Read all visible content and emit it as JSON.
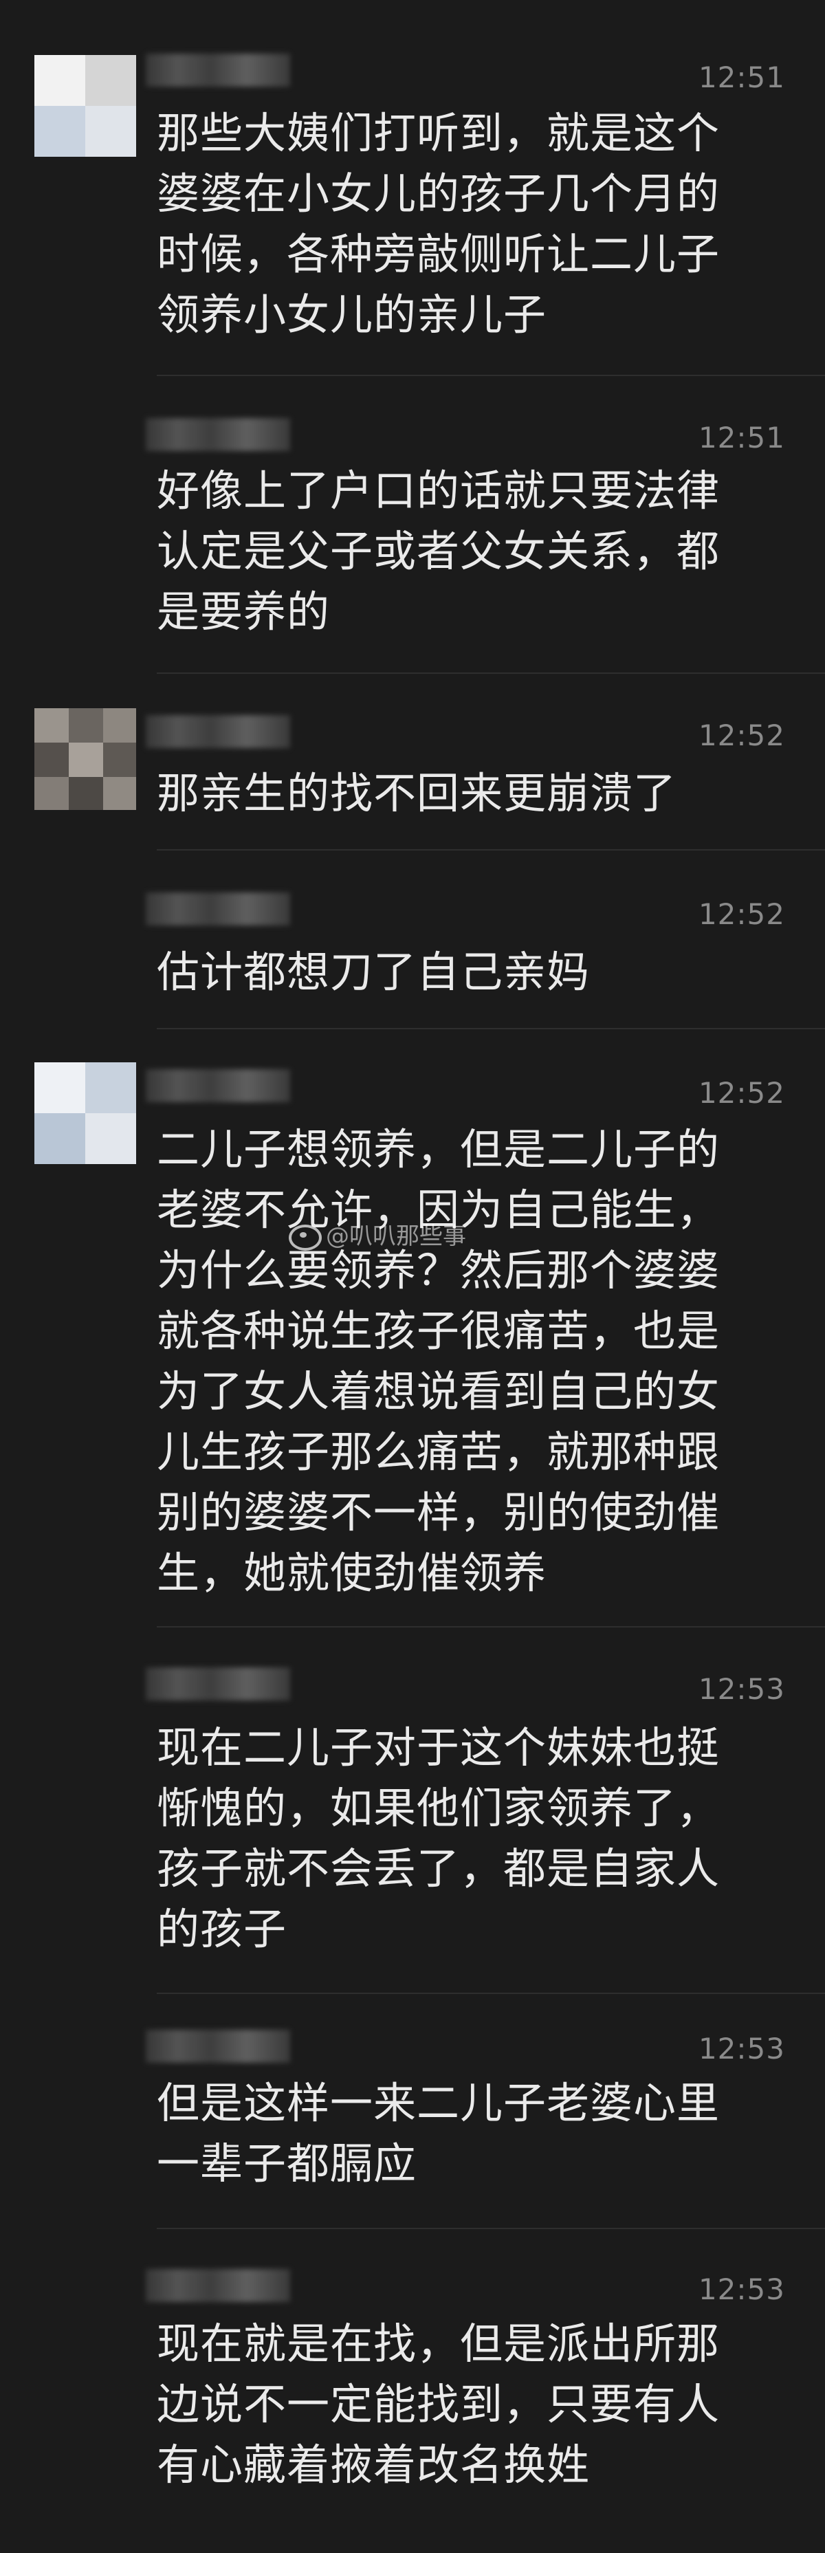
{
  "chat": {
    "messages": [
      {
        "time": "12:51",
        "lines": [
          "那些大姨们打听到，就是这个",
          "婆婆在小女儿的孩子几个月的",
          "时候，各种旁敲侧听让二儿子",
          "领养小女儿的亲儿子"
        ]
      },
      {
        "time": "12:51",
        "lines": [
          "好像上了户口的话就只要法律",
          "认定是父子或者父女关系，都",
          "是要养的"
        ]
      },
      {
        "time": "12:52",
        "lines": [
          "那亲生的找不回来更崩溃了"
        ]
      },
      {
        "time": "12:52",
        "lines": [
          "估计都想刀了自己亲妈"
        ]
      },
      {
        "time": "12:52",
        "lines": [
          "二儿子想领养，但是二儿子的",
          "老婆不允许，因为自己能生，",
          "为什么要领养？然后那个婆婆",
          "就各种说生孩子很痛苦，也是",
          "为了女人着想说看到自己的女",
          "儿生孩子那么痛苦，就那种跟",
          "别的婆婆不一样，别的使劲催",
          "生，她就使劲催领养"
        ]
      },
      {
        "time": "12:53",
        "lines": [
          "现在二儿子对于这个妹妹也挺",
          "惭愧的，如果他们家领养了，",
          "孩子就不会丢了，都是自家人",
          "的孩子"
        ]
      },
      {
        "time": "12:53",
        "lines": [
          "但是这样一来二儿子老婆心里",
          "一辈子都膈应"
        ]
      },
      {
        "time": "12:53",
        "lines": [
          "现在就是在找，但是派出所那",
          "边说不一定能找到，只要有人",
          "有心藏着掖着改名换姓"
        ]
      }
    ],
    "watermark": "@叭叭那些事",
    "watermark_icon": "weibo-icon",
    "colors": {
      "background": "#1b1b1b",
      "text": "#eaeaea",
      "time": "#8a8a8a",
      "divider": "#2e2e2e"
    }
  }
}
